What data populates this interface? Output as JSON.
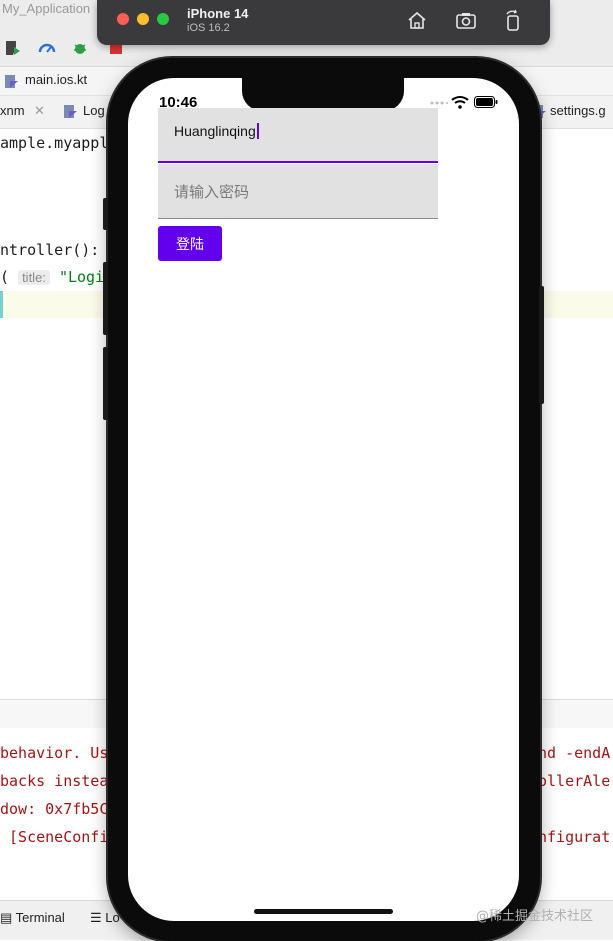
{
  "ide": {
    "app_title": "My_Application",
    "breadcrumb": "main.ios.kt",
    "tabs": [
      "xnm",
      "Log",
      "settings.g"
    ],
    "code_lines": {
      "line1": "ample.myappl",
      "line2": "ntroller():",
      "line3_prefix": "(",
      "line3_hint": "title:",
      "line3_string": "\"Logi",
      "console1": "behavior. Us",
      "console1_right": "nd -endA",
      "console2": "backs instea",
      "console2_right": "ollerAle",
      "console3": "dow: 0x7fb5C",
      "console4": " [SceneConfi",
      "console4_right": "nfigurat"
    },
    "bottom_tabs": [
      "Terminal",
      "Lo"
    ]
  },
  "simulator": {
    "device_name": "iPhone 14",
    "os_version": "iOS 16.2",
    "toolbar_icons": [
      "home-icon",
      "screenshot-icon",
      "rotate-icon"
    ]
  },
  "phone": {
    "status_time": "10:46",
    "username_value": "Huanglinqing",
    "password_placeholder": "请输入密码",
    "login_label": "登陆"
  },
  "watermark": "@稀土掘金技术社区",
  "colors": {
    "accent": "#6200ee",
    "field_bg": "#e1e1e1",
    "sim_bar": "#3a3a3c",
    "traffic_red": "#ff5f57",
    "traffic_yellow": "#febc2e",
    "traffic_green": "#28c840"
  }
}
